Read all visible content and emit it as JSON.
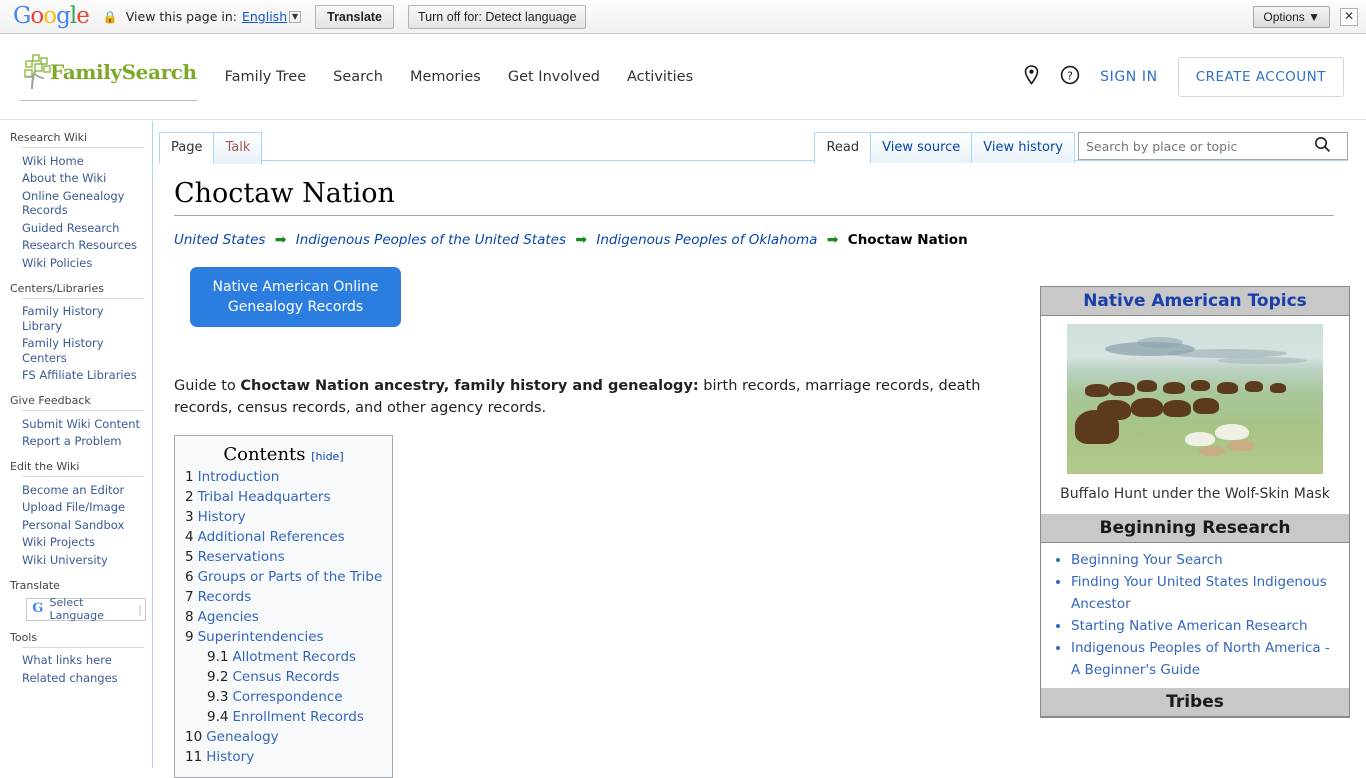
{
  "translate_bar": {
    "logo_letters": [
      "G",
      "o",
      "o",
      "g",
      "l",
      "e"
    ],
    "lock_icon": "lock-icon",
    "label": "View this page in:",
    "language": "English",
    "translate_button": "Translate",
    "turn_off_button": "Turn off for: Detect language",
    "options_button": "Options ▼",
    "close_button": "✕"
  },
  "header": {
    "brand": "FamilySearch",
    "nav": [
      {
        "label": "Family Tree"
      },
      {
        "label": "Search"
      },
      {
        "label": "Memories"
      },
      {
        "label": "Get Involved"
      },
      {
        "label": "Activities"
      }
    ],
    "location_icon": "location-pin-icon",
    "help_icon": "help-circle-icon",
    "sign_in": "SIGN IN",
    "create_account": "CREATE ACCOUNT",
    "brand_color": "#7fa82b",
    "link_color": "#2f6fc4"
  },
  "sidebar": {
    "sections": [
      {
        "heading": "Research Wiki",
        "items": [
          "Wiki Home",
          "About the Wiki",
          "Online Genealogy Records",
          "Guided Research",
          "Research Resources",
          "Wiki Policies"
        ]
      },
      {
        "heading": "Centers/Libraries",
        "items": [
          "Family History Library",
          "Family History Centers",
          "FS Affiliate Libraries"
        ]
      },
      {
        "heading": "Give Feedback",
        "items": [
          "Submit Wiki Content",
          "Report a Problem"
        ]
      },
      {
        "heading": "Edit the Wiki",
        "items": [
          "Become an Editor",
          "Upload File/Image",
          "Personal Sandbox",
          "Wiki Projects",
          "Wiki University"
        ]
      },
      {
        "heading": "Translate",
        "items": []
      },
      {
        "heading": "Tools",
        "items": [
          "What links here",
          "Related changes"
        ]
      }
    ],
    "language_widget": {
      "icon": "google-g-icon",
      "label": "Select Language"
    }
  },
  "tabs": {
    "left": [
      {
        "label": "Page",
        "selected": true
      },
      {
        "label": "Talk",
        "selected": false
      }
    ],
    "right": [
      {
        "label": "Read",
        "selected": true
      },
      {
        "label": "View source",
        "selected": false
      },
      {
        "label": "View history",
        "selected": false
      }
    ]
  },
  "search": {
    "placeholder": "Search by place or topic",
    "value": "",
    "icon": "search-icon"
  },
  "page": {
    "title": "Choctaw Nation",
    "breadcrumb": {
      "links": [
        "United States",
        "Indigenous Peoples of the United States",
        "Indigenous Peoples of Oklahoma"
      ],
      "separator": "➡",
      "current": "Choctaw Nation"
    },
    "blue_button": "Native American Online Genealogy Records",
    "blue_button_color": "#2b7de0",
    "guide": {
      "prefix": "Guide to ",
      "bold": "Choctaw Nation ancestry, family history and genealogy:",
      "suffix": " birth records, marriage records, death records, census records, and other agency records."
    }
  },
  "toc": {
    "title": "Contents",
    "hide_label": "[hide]",
    "entries": [
      {
        "num": "1",
        "label": "Introduction",
        "sub": false
      },
      {
        "num": "2",
        "label": "Tribal Headquarters",
        "sub": false
      },
      {
        "num": "3",
        "label": "History",
        "sub": false
      },
      {
        "num": "4",
        "label": "Additional References",
        "sub": false
      },
      {
        "num": "5",
        "label": "Reservations",
        "sub": false
      },
      {
        "num": "6",
        "label": "Groups or Parts of the Tribe",
        "sub": false
      },
      {
        "num": "7",
        "label": "Records",
        "sub": false
      },
      {
        "num": "8",
        "label": "Agencies",
        "sub": false
      },
      {
        "num": "9",
        "label": "Superintendencies",
        "sub": false
      },
      {
        "num": "9.1",
        "label": "Allotment Records",
        "sub": true
      },
      {
        "num": "9.2",
        "label": "Census Records",
        "sub": true
      },
      {
        "num": "9.3",
        "label": "Correspondence",
        "sub": true
      },
      {
        "num": "9.4",
        "label": "Enrollment Records",
        "sub": true
      },
      {
        "num": "10",
        "label": "Genealogy",
        "sub": false
      },
      {
        "num": "11",
        "label": "History",
        "sub": false
      }
    ]
  },
  "infobox": {
    "title": "Native American Topics",
    "image_caption": "Buffalo Hunt under the Wolf-Skin Mask",
    "sections": [
      {
        "heading": "Beginning Research",
        "links": [
          "Beginning Your Search",
          "Finding Your United States Indigenous Ancestor",
          "Starting Native American Research",
          "Indigenous Peoples of North America - A Beginner's Guide"
        ]
      },
      {
        "heading": "Tribes",
        "links": []
      }
    ],
    "heading_bg": "#c8c8c8",
    "title_color": "#1b3faa"
  }
}
